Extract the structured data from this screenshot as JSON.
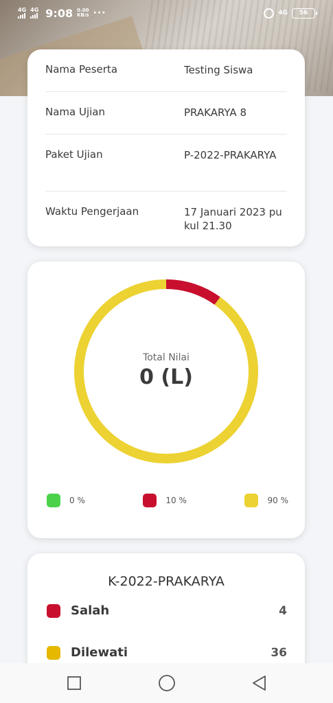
{
  "status_bar": {
    "signal_1": "4G",
    "signal_2": "4G",
    "time": "9:08",
    "speed_value": "0.00",
    "speed_unit": "KB/s",
    "more": "···",
    "network": "4G",
    "battery": "56"
  },
  "info": {
    "rows": [
      {
        "label": "Nama Peserta",
        "value": "Testing Siswa"
      },
      {
        "label": "Nama Ujian",
        "value": "PRAKARYA 8"
      },
      {
        "label": "Paket Ujian",
        "value": "P-2022-PRAKARYA"
      },
      {
        "label": "Waktu Pengerjaan",
        "value": "17 Januari 2023 pukul 21.30"
      }
    ]
  },
  "chart_data": {
    "type": "pie",
    "title": "Total Nilai",
    "center_value": "0 (L)",
    "categories": [
      "0 %",
      "10 %",
      "90 %"
    ],
    "values": [
      0,
      10,
      90
    ],
    "colors": [
      "#4cd24a",
      "#c8102e",
      "#ecd232"
    ],
    "legend_position": "bottom"
  },
  "summary": {
    "title": "K-2022-PRAKARYA",
    "rows": [
      {
        "label": "Salah",
        "count": "4",
        "color": "#c8102e"
      },
      {
        "label": "Dilewati",
        "count": "36",
        "color": "#e6b800"
      }
    ]
  },
  "nav": {
    "recent": "square-icon",
    "home": "circle-icon",
    "back": "triangle-back-icon"
  }
}
